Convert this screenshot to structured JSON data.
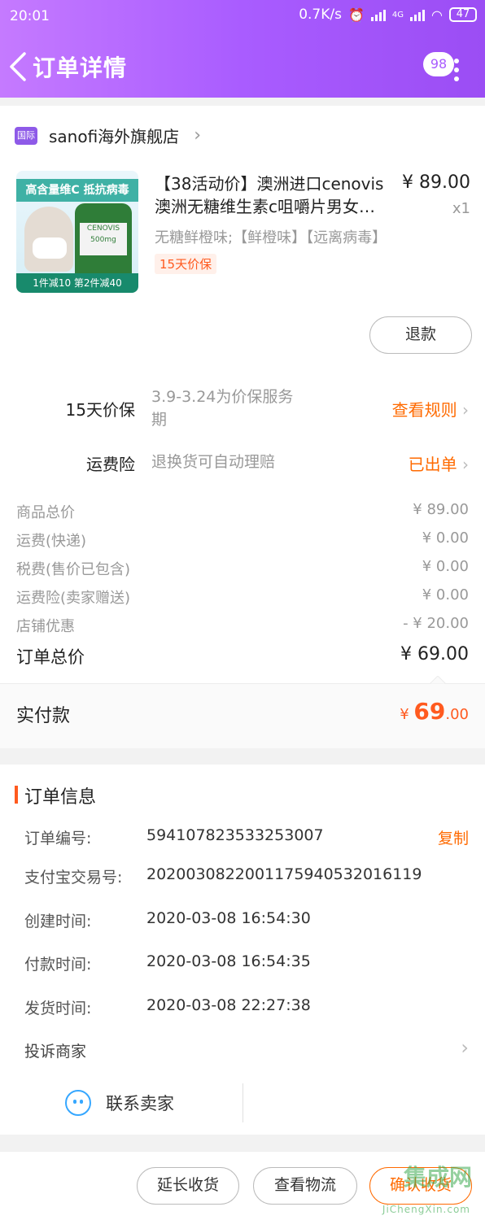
{
  "status_bar": {
    "time": "20:01",
    "speed": "0.7K/s",
    "network": "4G",
    "battery": "47"
  },
  "nav": {
    "title": "订单详情",
    "badge": "98"
  },
  "store": {
    "logo_text": "国际",
    "name": "sanofi海外旗舰店"
  },
  "product": {
    "image_banner": "高含量维C 抵抗病毒",
    "image_label": "CENOVIS 500mg",
    "image_promo": "1件减10 第2件减40",
    "title_line1": "【38活动价】澳洲进口cenovis",
    "title_line2": "澳洲无糖维生素c咀嚼片男女…",
    "price": "¥ 89.00",
    "qty": "x1",
    "spec": "无糖鲜橙味;【鲜橙味】【远离病毒】",
    "tag": "15天价保",
    "refund_button": "退款"
  },
  "services": [
    {
      "label": "15天价保",
      "desc_line1": "3.9-3.24为价保服务",
      "desc_line2": "期",
      "link": "查看规则"
    },
    {
      "label": "运费险",
      "desc_line1": "退换货可自动理赔",
      "desc_line2": "",
      "link": "已出单"
    }
  ],
  "price_details": [
    {
      "label": "商品总价",
      "value": "¥ 89.00"
    },
    {
      "label": "运费(快递)",
      "value": "¥ 0.00"
    },
    {
      "label": "税费(售价已包含)",
      "value": "¥ 0.00"
    },
    {
      "label": "运费险(卖家赠送)",
      "value": "¥ 0.00"
    },
    {
      "label": "店铺优惠",
      "value": "- ¥ 20.00"
    }
  ],
  "order_total": {
    "label": "订单总价",
    "value": "¥ 69.00"
  },
  "paid": {
    "label": "实付款",
    "currency": "¥",
    "integer": "69",
    "decimal": ".00"
  },
  "order_info": {
    "title": "订单信息",
    "rows": [
      {
        "key": "订单编号:",
        "value": "594107823533253007"
      },
      {
        "key": "支付宝交易号:",
        "value": "2020030822001175940532016119"
      },
      {
        "key": "创建时间:",
        "value": "2020-03-08 16:54:30"
      },
      {
        "key": "付款时间:",
        "value": "2020-03-08 16:54:35"
      },
      {
        "key": "发货时间:",
        "value": "2020-03-08 22:27:38"
      }
    ],
    "copy_label": "复制",
    "complain": "投诉商家",
    "contact": "联系卖家"
  },
  "bottom_actions": {
    "extend": "延长收货",
    "logistics": "查看物流",
    "confirm": "确认收货"
  },
  "watermark": {
    "main": "集成网",
    "sub": "JiChengXin.com"
  },
  "colors": {
    "header_start": "#c57aff",
    "header_end": "#9b4df4",
    "accent": "#ff6a00",
    "price_orange": "#ff5a1f"
  }
}
